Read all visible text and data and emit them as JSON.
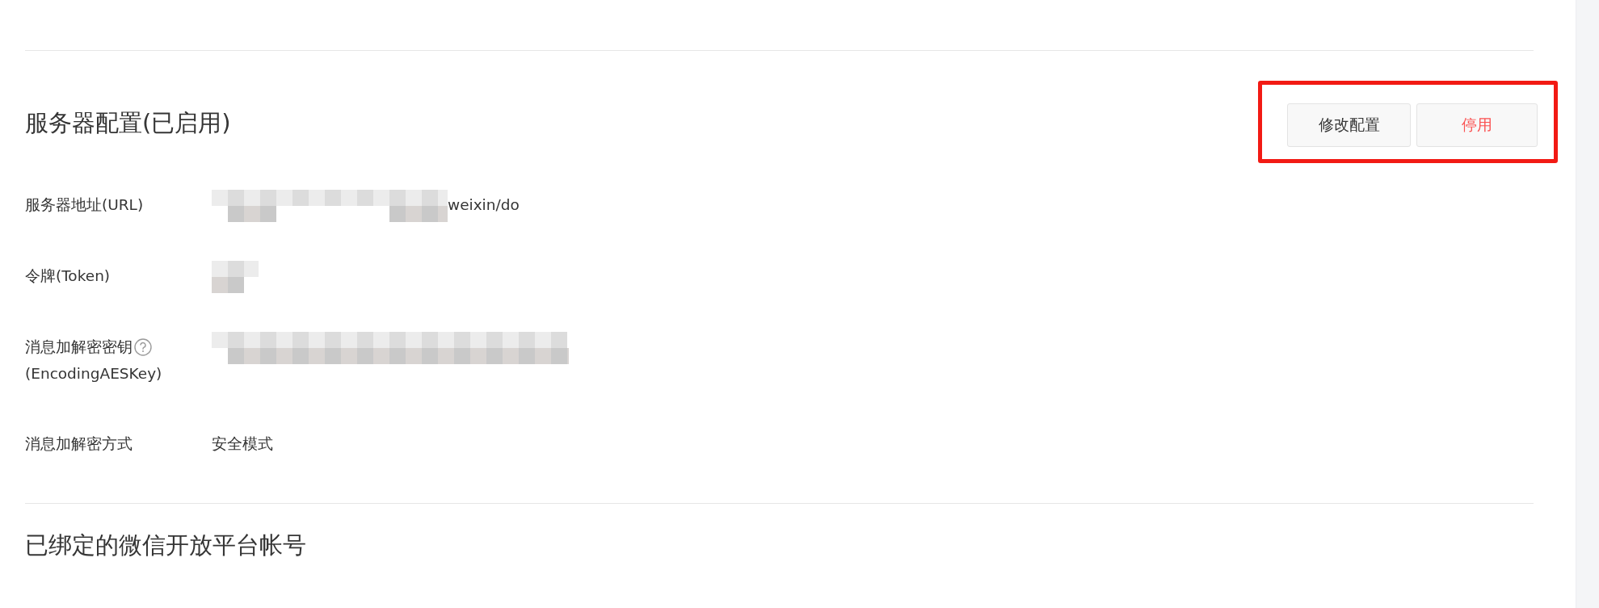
{
  "server_config": {
    "title": "服务器配置(已启用)",
    "buttons": [
      {
        "label": "修改配置",
        "kind": "normal"
      },
      {
        "label": "停用",
        "kind": "danger"
      }
    ],
    "fields": [
      {
        "label": "服务器地址(URL)",
        "kind": "url",
        "value": "weixin/do"
      },
      {
        "label": "令牌(Token)",
        "kind": "token"
      },
      {
        "label": "消息加解密密钥",
        "label_line_2": "(EncodingAESKey)",
        "kind": "key",
        "help": true
      },
      {
        "label": "消息加解密方式",
        "kind": "text",
        "value": "安全模式"
      }
    ]
  },
  "open_platform": {
    "title": "已绑定的微信开放平台帐号"
  }
}
